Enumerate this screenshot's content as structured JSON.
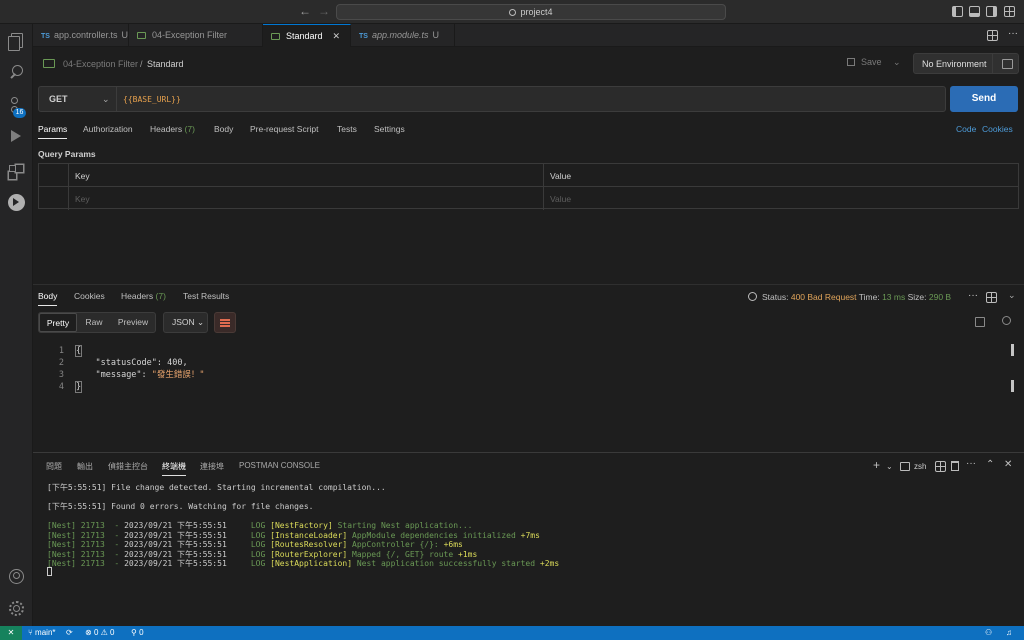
{
  "titlebar": {
    "search": "project4",
    "back": "←",
    "forward": "→"
  },
  "tabs": [
    {
      "lang": "TS",
      "label": "app.controller.ts",
      "mark": "U",
      "active": false
    },
    {
      "lang": "",
      "label": "04-Exception Filter",
      "mark": "",
      "active": false
    },
    {
      "lang": "",
      "label": "Standard",
      "mark": "",
      "active": true
    },
    {
      "lang": "TS",
      "label": "app.module.ts",
      "mark": "U",
      "active": false
    }
  ],
  "tabs_close": "✕",
  "request": {
    "breadcrumb_collection": "04-Exception Filter",
    "breadcrumb_sep": "/",
    "breadcrumb_request": "Standard",
    "save_label": "Save",
    "environment": "No Environment",
    "method": "GET",
    "url": "{{BASE_URL}}",
    "send_label": "Send",
    "tabs": {
      "params": "Params",
      "authorization": "Authorization",
      "headers": "Headers",
      "headers_count": "(7)",
      "body": "Body",
      "prerequest": "Pre-request Script",
      "tests": "Tests",
      "settings": "Settings"
    },
    "code_link": "Code",
    "cookies_link": "Cookies",
    "query_params_title": "Query Params",
    "table": {
      "key_header": "Key",
      "value_header": "Value",
      "key_placeholder": "Key",
      "value_placeholder": "Value"
    }
  },
  "response": {
    "tabs": {
      "body": "Body",
      "cookies": "Cookies",
      "headers": "Headers",
      "headers_count": "(7)",
      "test_results": "Test Results"
    },
    "status_label": "Status:",
    "status_value": "400 Bad Request",
    "time_label": "Time:",
    "time_value": "13 ms",
    "size_label": "Size:",
    "size_value": "290 B",
    "format": {
      "pretty": "Pretty",
      "raw": "Raw",
      "preview": "Preview",
      "type": "JSON"
    },
    "lines": [
      "1",
      "2",
      "3",
      "4"
    ],
    "json": {
      "open": "{",
      "key1": "\"statusCode\"",
      "colon": ": ",
      "val1": "400",
      "comma": ",",
      "key2": "\"message\"",
      "val2": "\"發生錯誤！\"",
      "close": "}"
    }
  },
  "panel": {
    "tabs": [
      "問題",
      "輸出",
      "偵錯主控台",
      "終端機",
      "連接埠",
      "POSTMAN CONSOLE"
    ],
    "active_tab": "終端機",
    "shell": "zsh",
    "terminal": {
      "line1": "[下午5:55:51] File change detected. Starting incremental compilation...",
      "line2": "[下午5:55:51] Found 0 errors. Watching for file changes.",
      "logs": [
        {
          "prefix": "[Nest] 21713  - ",
          "date": "2023/09/21 下午5:55:51",
          "level": "LOG",
          "ctx": "[NestFactory]",
          "msg": "Starting Nest application...",
          "time": ""
        },
        {
          "prefix": "[Nest] 21713  - ",
          "date": "2023/09/21 下午5:55:51",
          "level": "LOG",
          "ctx": "[InstanceLoader]",
          "msg": "AppModule dependencies initialized",
          "time": "+7ms"
        },
        {
          "prefix": "[Nest] 21713  - ",
          "date": "2023/09/21 下午5:55:51",
          "level": "LOG",
          "ctx": "[RoutesResolver]",
          "msg": "AppController {/}:",
          "time": "+6ms"
        },
        {
          "prefix": "[Nest] 21713  - ",
          "date": "2023/09/21 下午5:55:51",
          "level": "LOG",
          "ctx": "[RouterExplorer]",
          "msg": "Mapped {/, GET} route",
          "time": "+1ms"
        },
        {
          "prefix": "[Nest] 21713  - ",
          "date": "2023/09/21 下午5:55:51",
          "level": "LOG",
          "ctx": "[NestApplication]",
          "msg": "Nest application successfully started",
          "time": "+2ms"
        }
      ]
    }
  },
  "statusbar": {
    "remote": "✕",
    "branch": "main*",
    "errors": "0",
    "warnings": "0",
    "ports": "0",
    "activity_badge": "16"
  }
}
